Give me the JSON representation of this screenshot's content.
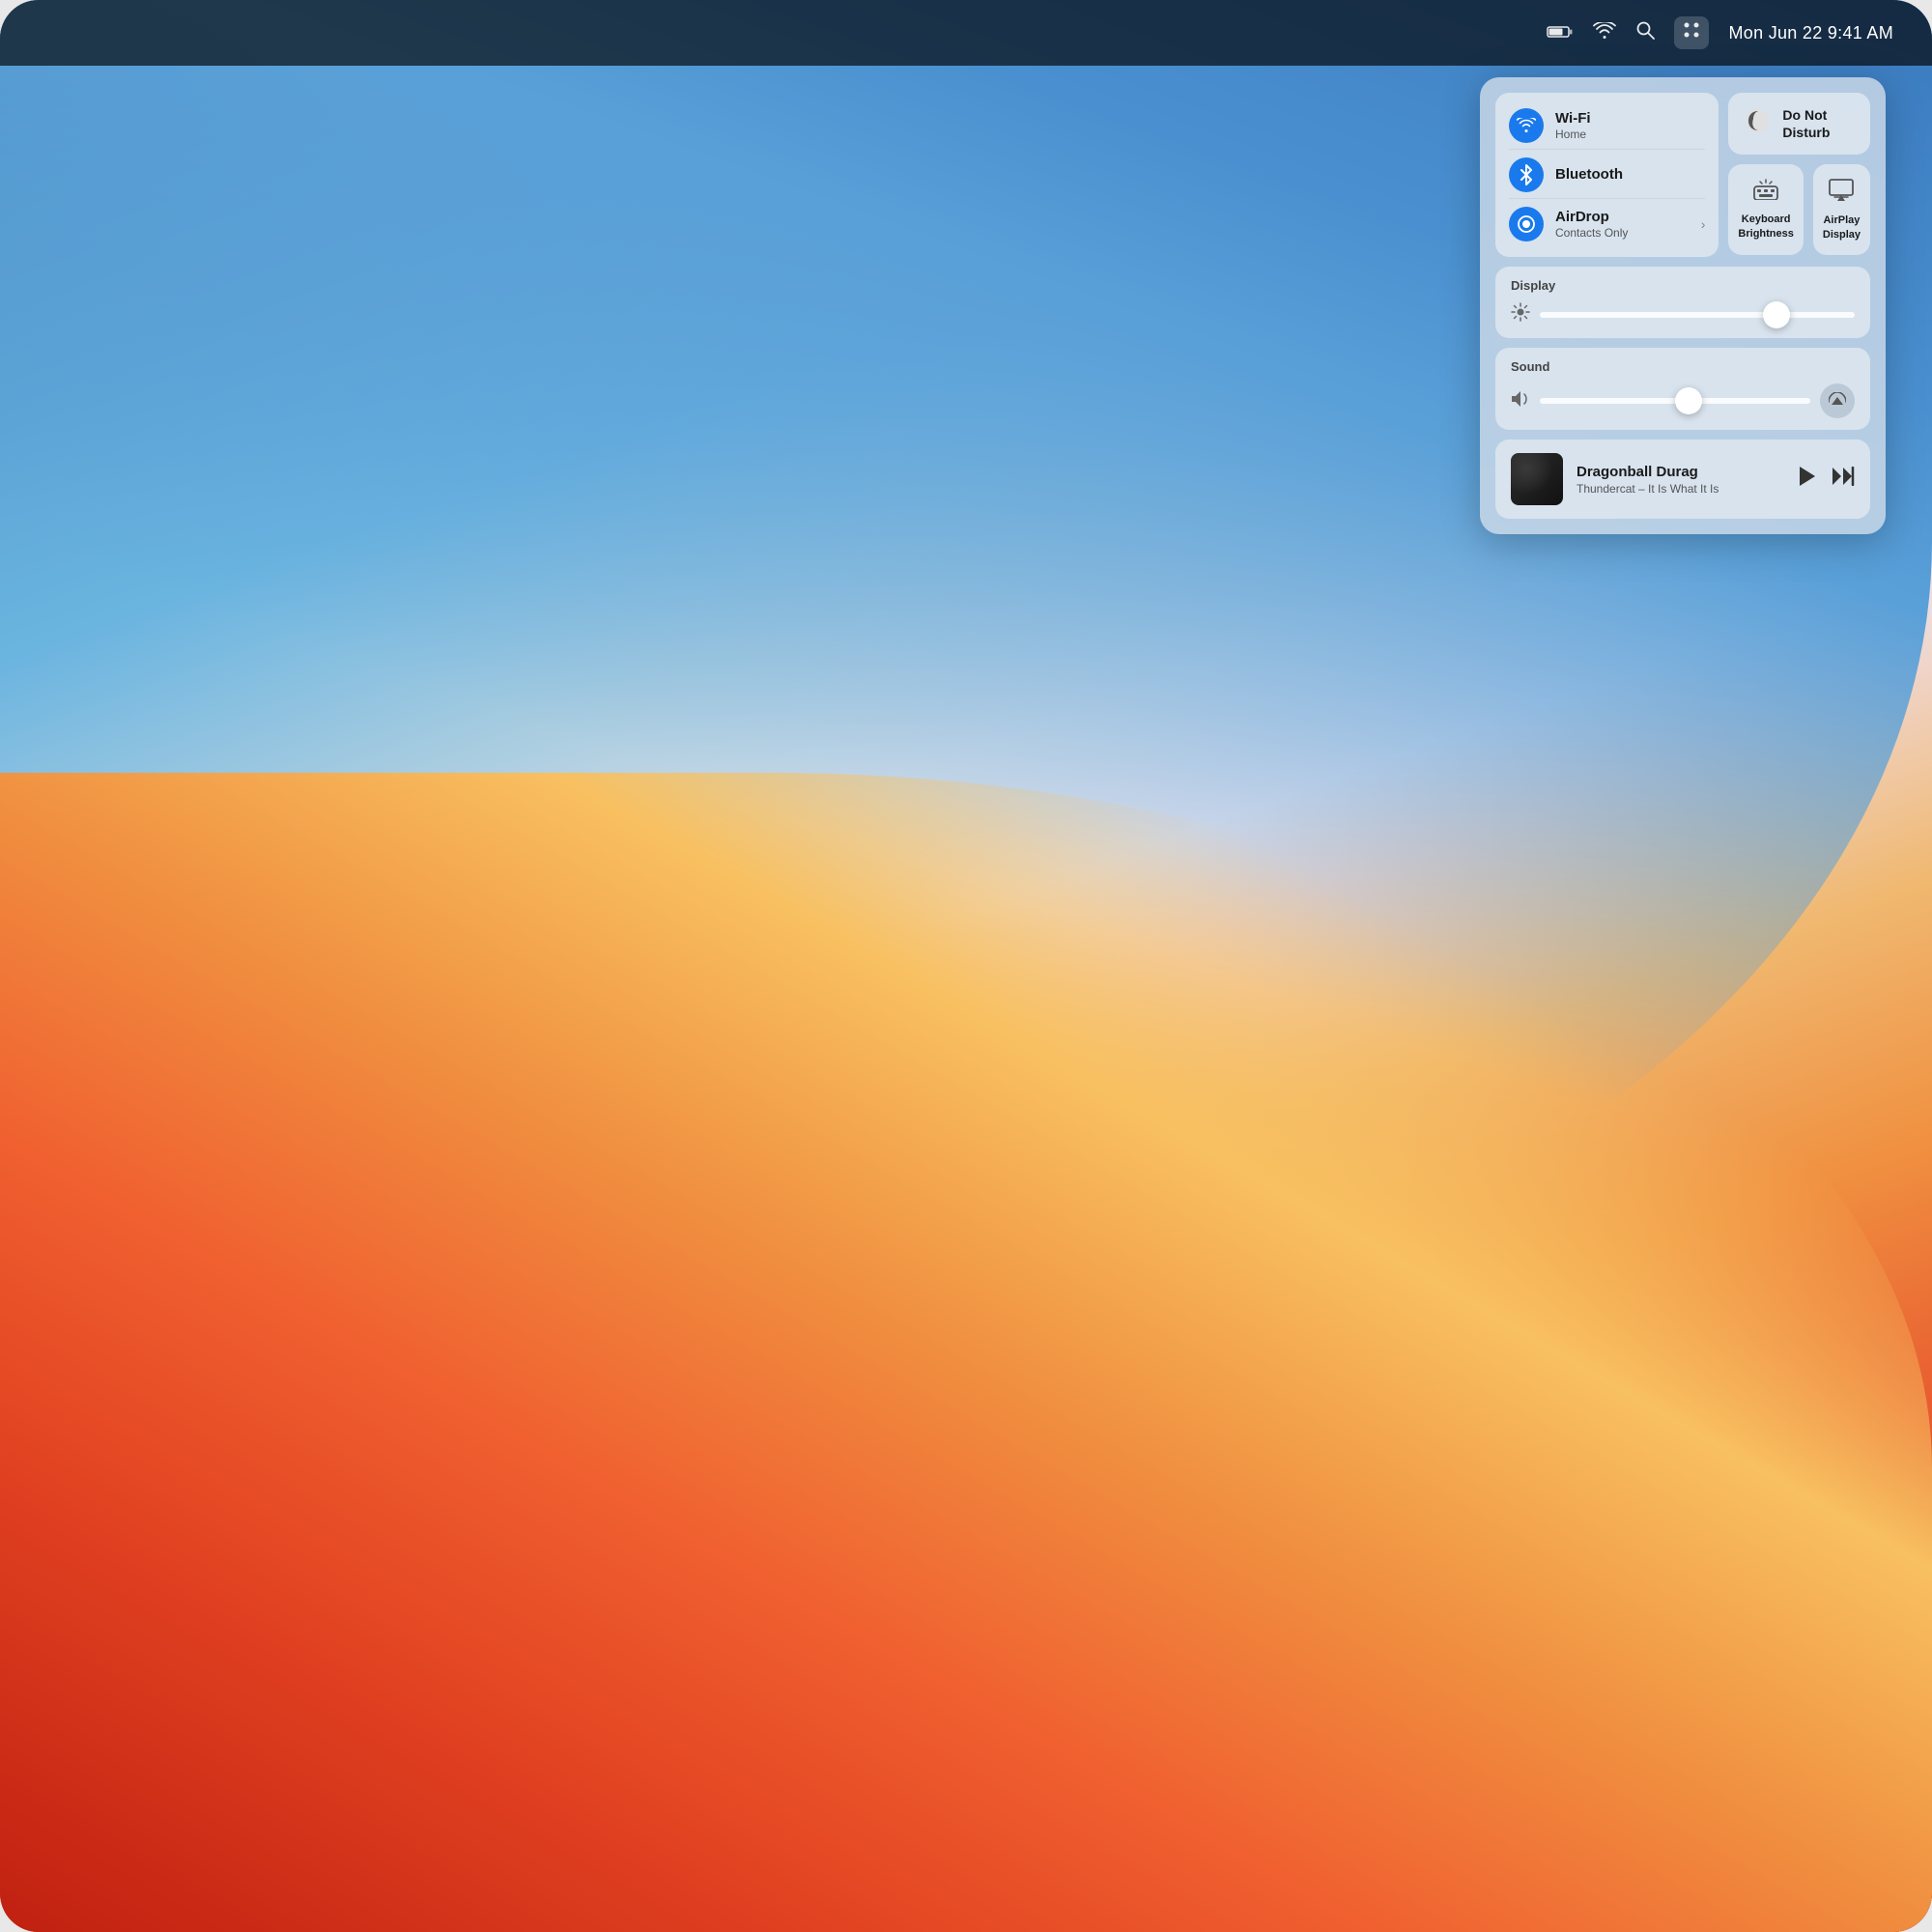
{
  "menubar": {
    "datetime": "Mon Jun 22  9:41 AM",
    "icons": {
      "battery": "🔋",
      "wifi": "📶",
      "search": "🔍",
      "control_center": "⊞"
    }
  },
  "control_center": {
    "wifi": {
      "name": "Wi-Fi",
      "sub": "Home",
      "icon": "wifi"
    },
    "bluetooth": {
      "name": "Bluetooth",
      "sub": "",
      "icon": "bluetooth"
    },
    "airdrop": {
      "name": "AirDrop",
      "sub": "Contacts Only",
      "icon": "airdrop"
    },
    "do_not_disturb": {
      "label": "Do Not Disturb"
    },
    "keyboard_brightness": {
      "label": "Keyboard Brightness"
    },
    "airplay_display": {
      "label": "AirPlay Display"
    },
    "display": {
      "section_label": "Display",
      "brightness": 75
    },
    "sound": {
      "section_label": "Sound",
      "volume": 55
    },
    "now_playing": {
      "title": "Dragonball Durag",
      "artist": "Thundercat – It Is What It Is"
    }
  }
}
